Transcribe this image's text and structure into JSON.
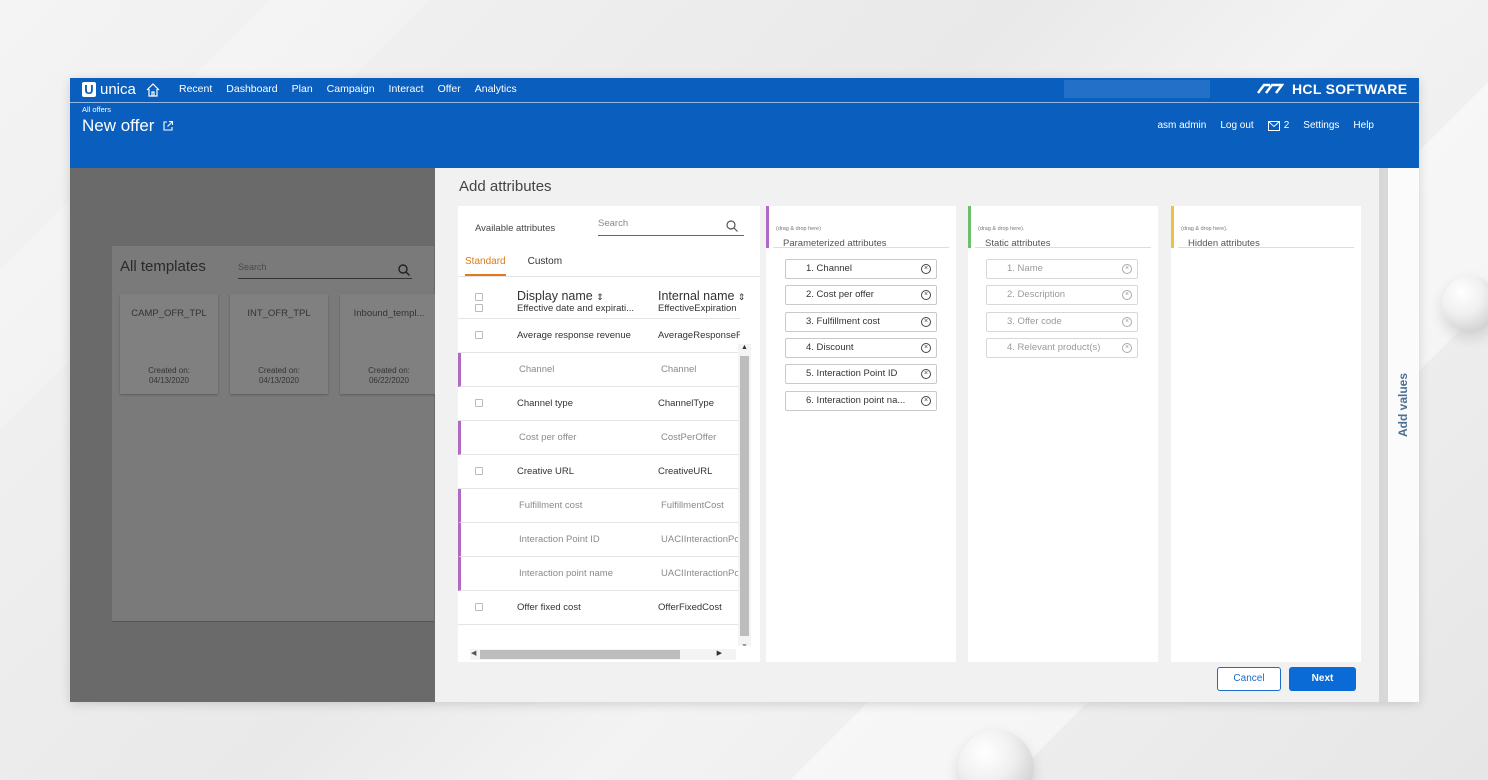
{
  "header": {
    "app_name": "unica",
    "nav": [
      "Recent",
      "Dashboard",
      "Plan",
      "Campaign",
      "Interact",
      "Offer",
      "Analytics"
    ],
    "brand": "HCL SOFTWARE",
    "breadcrumb": "All offers",
    "page_title": "New offer",
    "user": "asm admin",
    "logout": "Log out",
    "mail_count": "2",
    "settings": "Settings",
    "help": "Help"
  },
  "templates": {
    "title": "All templates",
    "search_placeholder": "Search",
    "cards": [
      {
        "name": "CAMP_OFR_TPL",
        "created_label": "Created on:",
        "date": "04/13/2020"
      },
      {
        "name": "INT_OFR_TPL",
        "created_label": "Created on:",
        "date": "04/13/2020"
      },
      {
        "name": "Inbound_templ...",
        "created_label": "Created on:",
        "date": "06/22/2020"
      }
    ]
  },
  "modal": {
    "title": "Add attributes",
    "available": {
      "label": "Available attributes",
      "search_placeholder": "Search",
      "tabs": [
        "Standard",
        "Custom"
      ],
      "col_display": "Display name",
      "col_internal": "Internal name",
      "rows": [
        {
          "display": "Effective date and expirati...",
          "internal": "EffectiveExpiration",
          "used": false
        },
        {
          "display": "Average response revenue",
          "internal": "AverageResponseR",
          "used": false
        },
        {
          "display": "Channel",
          "internal": "Channel",
          "used": true
        },
        {
          "display": "Channel type",
          "internal": "ChannelType",
          "used": false
        },
        {
          "display": "Cost per offer",
          "internal": "CostPerOffer",
          "used": true
        },
        {
          "display": "Creative URL",
          "internal": "CreativeURL",
          "used": false
        },
        {
          "display": "Fulfillment cost",
          "internal": "FulfillmentCost",
          "used": true
        },
        {
          "display": "Interaction Point ID",
          "internal": "UACIInteractionPo",
          "used": true
        },
        {
          "display": "Interaction point name",
          "internal": "UACIInteractionPo",
          "used": true
        },
        {
          "display": "Offer fixed cost",
          "internal": "OfferFixedCost",
          "used": false
        }
      ]
    },
    "parameterized": {
      "title": "Parameterized attributes",
      "hint": "(drag & drop here)",
      "color": "#b06ac4",
      "items": [
        "1. Channel",
        "2. Cost per offer",
        "3. Fulfillment cost",
        "4. Discount",
        "5. Interaction Point ID",
        "6. Interaction point na..."
      ]
    },
    "static": {
      "title": "Static attributes",
      "hint": "(drag & drop here).",
      "color": "#6cc06a",
      "items": [
        "1. Name",
        "2. Description",
        "3. Offer code",
        "4. Relevant product(s)"
      ]
    },
    "hidden": {
      "title": "Hidden attributes",
      "hint": "(drag & drop here).",
      "color": "#f0c040",
      "items": []
    },
    "cancel": "Cancel",
    "next": "Next",
    "side_tab": "Add values"
  }
}
